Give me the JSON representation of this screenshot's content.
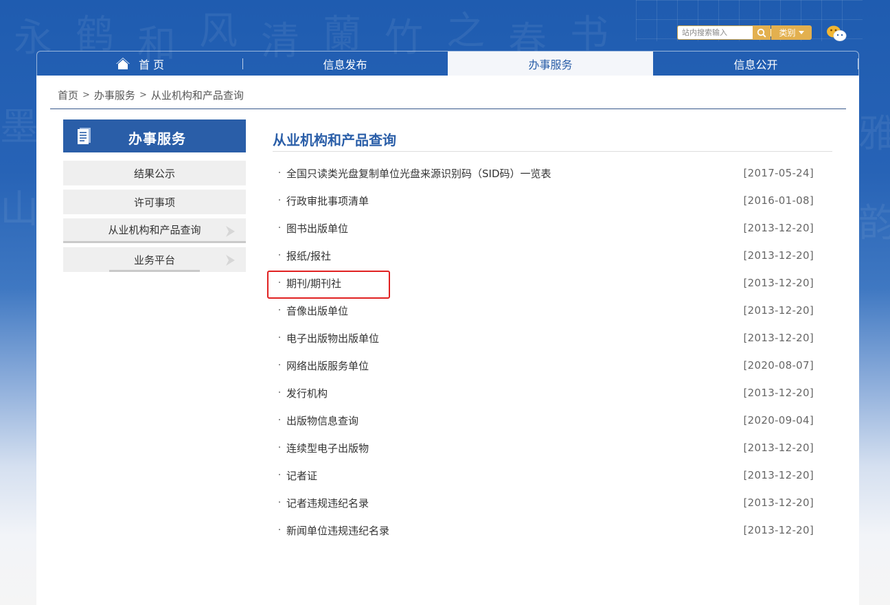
{
  "header": {
    "search": {
      "placeholder": "站内搜索输入",
      "category_label": "类别"
    },
    "icons": {
      "search": "search-icon",
      "wechat": "wechat-icon"
    }
  },
  "nav": {
    "items": [
      {
        "label": "首 页",
        "icon": "home-icon",
        "active": false
      },
      {
        "label": "信息发布",
        "active": false
      },
      {
        "label": "办事服务",
        "active": true
      },
      {
        "label": "信息公开",
        "active": false
      }
    ]
  },
  "breadcrumb": {
    "items": [
      "首页",
      "办事服务",
      "从业机构和产品查询"
    ],
    "separator": ">"
  },
  "sidebar": {
    "title": "办事服务",
    "icon": "document-icon",
    "items": [
      {
        "label": "结果公示"
      },
      {
        "label": "许可事项"
      },
      {
        "label": "从业机构和产品查询"
      },
      {
        "label": "业务平台"
      }
    ]
  },
  "main": {
    "title": "从业机构和产品查询",
    "bullet": "·",
    "list": [
      {
        "title": "全国只读类光盘复制单位光盘来源识别码（SID码）一览表",
        "date": "[2017-05-24]"
      },
      {
        "title": "行政审批事项清单",
        "date": "[2016-01-08]"
      },
      {
        "title": "图书出版单位",
        "date": "[2013-12-20]"
      },
      {
        "title": "报纸/报社",
        "date": "[2013-12-20]"
      },
      {
        "title": "期刊/期刊社",
        "date": "[2013-12-20]"
      },
      {
        "title": "音像出版单位",
        "date": "[2013-12-20]"
      },
      {
        "title": "电子出版物出版单位",
        "date": "[2013-12-20]"
      },
      {
        "title": "网络出版服务单位",
        "date": "[2020-08-07]"
      },
      {
        "title": "发行机构",
        "date": "[2013-12-20]"
      },
      {
        "title": "出版物信息查询",
        "date": "[2020-09-04]"
      },
      {
        "title": "连续型电子出版物",
        "date": "[2013-12-20]"
      },
      {
        "title": "记者证",
        "date": "[2013-12-20]"
      },
      {
        "title": "记者违规违纪名录",
        "date": "[2013-12-20]"
      },
      {
        "title": "新闻单位违规违纪名录",
        "date": "[2013-12-20]"
      }
    ]
  },
  "colors": {
    "brand_blue": "#2a5ea8",
    "accent_gold": "#e3b04f",
    "highlight_red": "#e02020"
  }
}
